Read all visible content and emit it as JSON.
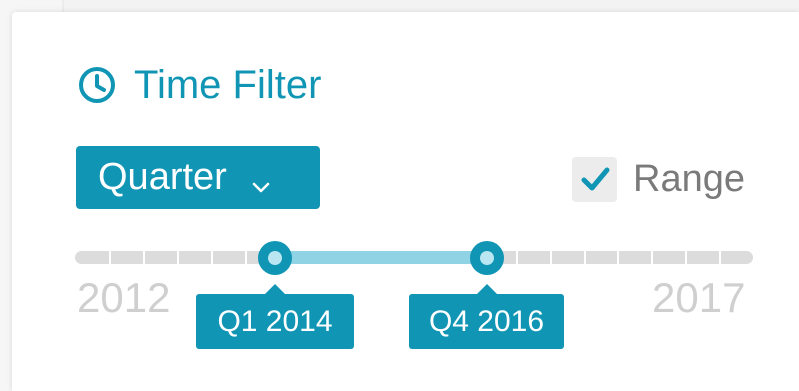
{
  "panel": {
    "title": "Time Filter",
    "title_icon": "clock-icon"
  },
  "granularity": {
    "label": "Quarter",
    "icon": "chevron-down-icon"
  },
  "range_toggle": {
    "label": "Range",
    "checked": true
  },
  "slider": {
    "min_label": "2012",
    "max_label": "2017",
    "start_label": "Q1 2014",
    "end_label": "Q4 2016"
  },
  "colors": {
    "accent": "#1096b4",
    "selected_track": "#8fd3e5",
    "track": "#dcdcdc",
    "muted_text": "#cfcfcf"
  }
}
